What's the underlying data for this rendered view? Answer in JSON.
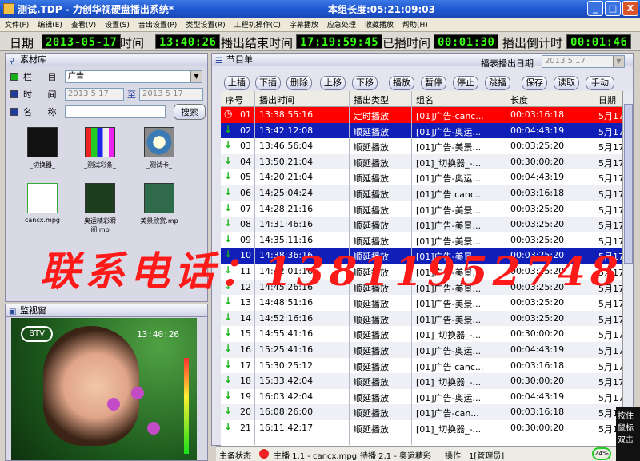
{
  "window": {
    "title": "测试.TDP - 力创华视硬盘播出系统*",
    "play_length": "本组长度:05:21:09:03",
    "min": "_",
    "max": "□",
    "close": "X"
  },
  "menu": [
    "文件(F)",
    "编辑(E)",
    "查看(V)",
    "设置(S)",
    "音出设置(P)",
    "类型设置(R)",
    "工程机操作(C)",
    "字幕播放",
    "应急处理",
    "收藏播放",
    "帮助(H)"
  ],
  "timebar": {
    "date_label": "日期",
    "date_value": "2013-05-17",
    "time_label": "时间",
    "time_value": "13:40:26",
    "end_label": "播出结束时间",
    "end_value": "17:19:59:45",
    "played_label": "已播时间",
    "played_value": "00:01:30",
    "countdown_label": "播出倒计时",
    "countdown_value": "00:01:46"
  },
  "library": {
    "title": "素材库",
    "column_label": "栏 目",
    "column_value": "广告",
    "time_label": "时 间",
    "time_from": "2013 5 17",
    "time_to_label": "至",
    "time_to": "2013 5 17",
    "name_label": "名 称",
    "search_button": "搜索",
    "items": [
      {
        "name": "_切换器_",
        "color": "#1a1a1a"
      },
      {
        "name": "_测试彩条_",
        "color": "#c0e0c0"
      },
      {
        "name": "_测试卡_",
        "color": "#3a7bb5"
      },
      {
        "name": "cancx.mpg",
        "color": "#ffffff"
      },
      {
        "name": "奥运精彩瞬间.mp",
        "color": "#1e3f1e"
      },
      {
        "name": "美景欣赏.mp",
        "color": "#2f6a4a"
      }
    ]
  },
  "monitor": {
    "title": "监视窗",
    "overlay_time": "13:40:26",
    "logo": "BTV"
  },
  "schedule": {
    "title": "节目单",
    "date_label": "播表播出日期",
    "date_value": "2013 5 17",
    "buttons": [
      "上插",
      "下插",
      "删除",
      "上移",
      "下移",
      "播放",
      "暂停",
      "停止",
      "跳播",
      "保存",
      "读取",
      "手动"
    ],
    "columns": [
      "序号",
      "播出时间",
      "播出类型",
      "组名",
      "长度",
      "日期"
    ],
    "rows": [
      {
        "no": "01",
        "time": "13:38:55:16",
        "type": "定时播放",
        "group": "[01]广告-canc...",
        "length": "00:03:16:18",
        "date": "5月17",
        "style": "red"
      },
      {
        "no": "02",
        "time": "13:42:12:08",
        "type": "顺延播放",
        "group": "[01]广告-奥运...",
        "length": "00:04:43:19",
        "date": "5月17",
        "style": "blue"
      },
      {
        "no": "03",
        "time": "13:46:56:04",
        "type": "顺延播放",
        "group": "[01]广告-美景...",
        "length": "00:03:25:20",
        "date": "5月17",
        "style": "white"
      },
      {
        "no": "04",
        "time": "13:50:21:04",
        "type": "顺延播放",
        "group": "[01]_切换器_-...",
        "length": "00:30:00:20",
        "date": "5月17",
        "style": "alt"
      },
      {
        "no": "05",
        "time": "14:20:21:04",
        "type": "顺延播放",
        "group": "[01]广告-奥运...",
        "length": "00:04:43:19",
        "date": "5月17",
        "style": "white"
      },
      {
        "no": "06",
        "time": "14:25:04:24",
        "type": "顺延播放",
        "group": "[01]广告 canc...",
        "length": "00:03:16:18",
        "date": "5月17",
        "style": "alt"
      },
      {
        "no": "07",
        "time": "14:28:21:16",
        "type": "顺延播放",
        "group": "[01]广告-美景...",
        "length": "00:03:25:20",
        "date": "5月17",
        "style": "white"
      },
      {
        "no": "08",
        "time": "14:31:46:16",
        "type": "顺延播放",
        "group": "[01]广告-美景...",
        "length": "00:03:25:20",
        "date": "5月17",
        "style": "alt"
      },
      {
        "no": "09",
        "time": "14:35:11:16",
        "type": "顺延播放",
        "group": "[01]广告-美景...",
        "length": "00:03:25:20",
        "date": "5月17",
        "style": "white"
      },
      {
        "no": "10",
        "time": "14:38:36:16",
        "type": "顺延播放",
        "group": "[01]广告-美景...",
        "length": "00:03:25:20",
        "date": "5月17",
        "style": "blue"
      },
      {
        "no": "11",
        "time": "14:42:01:16",
        "type": "顺延播放",
        "group": "[01]广告-美景...",
        "length": "00:03:25:20",
        "date": "5月17",
        "style": "white"
      },
      {
        "no": "12",
        "time": "14:45:26:16",
        "type": "顺延播放",
        "group": "[01]广告-美景...",
        "length": "00:03:25:20",
        "date": "5月17",
        "style": "alt"
      },
      {
        "no": "13",
        "time": "14:48:51:16",
        "type": "顺延播放",
        "group": "[01]广告-美景...",
        "length": "00:03:25:20",
        "date": "5月17",
        "style": "white"
      },
      {
        "no": "14",
        "time": "14:52:16:16",
        "type": "顺延播放",
        "group": "[01]广告-美景...",
        "length": "00:03:25:20",
        "date": "5月17",
        "style": "alt"
      },
      {
        "no": "15",
        "time": "14:55:41:16",
        "type": "顺延播放",
        "group": "[01]_切换器_-...",
        "length": "00:30:00:20",
        "date": "5月17",
        "style": "white"
      },
      {
        "no": "16",
        "time": "15:25:41:16",
        "type": "顺延播放",
        "group": "[01]广告-奥运...",
        "length": "00:04:43:19",
        "date": "5月17",
        "style": "alt"
      },
      {
        "no": "17",
        "time": "15:30:25:12",
        "type": "顺延播放",
        "group": "[01]广告 canc...",
        "length": "00:03:16:18",
        "date": "5月17",
        "style": "white"
      },
      {
        "no": "18",
        "time": "15:33:42:04",
        "type": "顺延播放",
        "group": "[01]_切换器_-...",
        "length": "00:30:00:20",
        "date": "5月17",
        "style": "alt"
      },
      {
        "no": "19",
        "time": "16:03:42:04",
        "type": "顺延播放",
        "group": "[01]广告-奥运...",
        "length": "00:04:43:19",
        "date": "5月17",
        "style": "white"
      },
      {
        "no": "20",
        "time": "16:08:26:00",
        "type": "顺延播放",
        "group": "[01]广告-can...",
        "length": "00:03:16:18",
        "date": "5月17",
        "style": "alt"
      },
      {
        "no": "21",
        "time": "16:11:42:17",
        "type": "顺延播放",
        "group": "[01]_切换器_-...",
        "length": "00:30:00:20",
        "date": "5月17",
        "style": "white"
      }
    ]
  },
  "statusbar": {
    "state_label": "主备状态",
    "main": "主播 1,1 - cancx.mpg",
    "standby": "待播 2,1 - 奥运精彩",
    "op_label": "操作",
    "op_value": "1[管理员]",
    "progress": "24%"
  },
  "watermark": "联系电话：13811952748",
  "side_tip": "按住 鼠标 双击"
}
